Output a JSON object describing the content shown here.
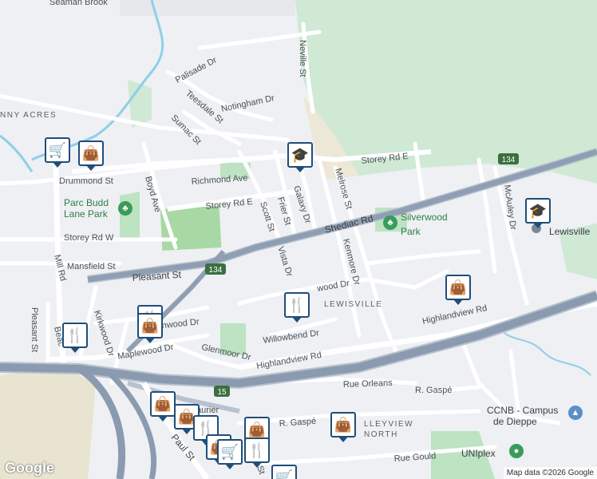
{
  "map": {
    "streets": {
      "seaman_brook": "Seaman Brook",
      "neville": "Neville St",
      "palisade": "Palisade Dr",
      "teesdale": "Teesdale St",
      "notingham": "Notingham Dr",
      "sumac": "Sumac St",
      "storey_e_top": "Storey Rd E",
      "drummond": "Drummond St",
      "richmond": "Richmond Ave",
      "galaxy": "Galaxy Dr",
      "melrose": "Melrose St",
      "boyd": "Boyd Ave",
      "storey_e_mid": "Storey Rd E",
      "frier": "Frier St",
      "scott": "Scott St",
      "shediac": "Shediac Rd",
      "storey_w": "Storey Rd W",
      "mill": "Mill Rd",
      "mansfield": "Mansfield St",
      "pleasant": "Pleasant St",
      "vista": "Vista Dr",
      "kenmore": "Kenmore Dr",
      "mcauley": "McAuley Dr",
      "wood": "wood Dr",
      "pleasant_st2": "Pleasant St",
      "kirkwood": "Kirkwood Dr",
      "glenwood": "Glenwood Dr",
      "highlandview_right": "Highlandview Rd",
      "willowbend": "Willowbend Dr",
      "maplewood": "Maplewood Dr",
      "glenmoor": "Glenmoor Dr",
      "highlandview_mid": "Highlandview Rd",
      "rue_orleans": "Rue Orleans",
      "r_gaspe": "R. Gaspé",
      "laurier": "aurier",
      "r_gaspe2": "R. Gaspé",
      "paul": "Paul St",
      "rue_gould": "Rue Gould",
      "beacon": "Beac"
    },
    "areas": {
      "nny_acres": "NNY ACRES",
      "lewisville": "LEWISVILLE",
      "lleyview_north": "LLEYVIEW",
      "north": "NORTH",
      "lewisville_poi": "Lewisville"
    },
    "parks": {
      "parc_budd_1": "Parc Budd",
      "parc_budd_2": "Lane Park",
      "silverwood_1": "Silverwood",
      "silverwood_2": "Park"
    },
    "places": {
      "ccnb_1": "CCNB - Campus",
      "ccnb_2": "de Dieppe",
      "uniplex": "UNIplex",
      "st_fragment": "St"
    },
    "highways": {
      "h134_top": "134",
      "h134_left": "134",
      "h15": "15"
    },
    "attribution": "Map data ©2026 Google",
    "logo": "Google",
    "icons": {
      "shopping": "shopping-bag-icon",
      "grocery": "shopping-cart-icon",
      "restaurant": "restaurant-icon",
      "school": "school-icon",
      "park": "park-icon"
    }
  }
}
